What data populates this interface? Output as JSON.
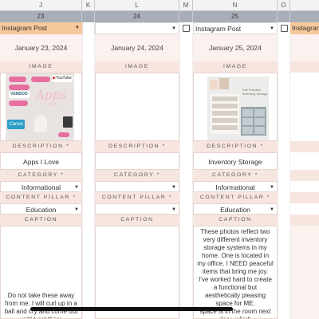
{
  "column_headers": [
    "J",
    "K",
    "L",
    "M",
    "N",
    "O"
  ],
  "row_numbers": [
    "23",
    "24",
    "25"
  ],
  "colors": {
    "header_pink": "#f7e5df",
    "light_pink": "#fbf1ee",
    "instagram_orange": "#f7c89b",
    "row_band": "#a8aeb8"
  },
  "columns": [
    {
      "platform": "Instagram Post",
      "date": "January 23, 2024",
      "image_label": "IMAGE",
      "description_label": "DESCRIPTION *",
      "description": "Apps I Love",
      "category_label": "CATEGORY *",
      "category": "Informational",
      "pillar_label": "CONTENT PILLAR *",
      "pillar": "Education",
      "caption_label": "CAPTION",
      "caption": "Do not take these away from me. I will curl up in a ball and cry and come out until I get them",
      "thumb": {
        "apps_text": "Apps",
        "subtitle": "I LOVE",
        "brands": [
          "YouTube",
          "VENDOO",
          "Canva"
        ]
      }
    },
    {
      "platform": "",
      "date": "January 24, 2024",
      "image_label": "IMAGE",
      "description_label": "DESCRIPTION *",
      "description": "",
      "category_label": "CATEGORY *",
      "category": "",
      "pillar_label": "CONTENT PILLAR *",
      "pillar": "",
      "caption_label": "CAPTION",
      "caption": ""
    },
    {
      "platform": "Instagram Post",
      "date": "January 25, 2024",
      "image_label": "IMAGE",
      "description_label": "DESCRIPTION *",
      "description": "Inventory Storage",
      "category_label": "CATEGORY *",
      "category": "Informational",
      "pillar_label": "CONTENT PILLAR *",
      "pillar": "Education",
      "caption_label": "CAPTION",
      "caption": "These photos reflect two very different inventory storage systems in my home. One is located in my office. I NEED peaceful items that bring me joy. I've worked hard to create a functional but aesthetically pleasing space for ME.",
      "caption_tail": "space is in the room next door, which",
      "thumb": {
        "title": "Fair Function Inventory Storage"
      }
    },
    {
      "platform": "Instagram"
    }
  ]
}
